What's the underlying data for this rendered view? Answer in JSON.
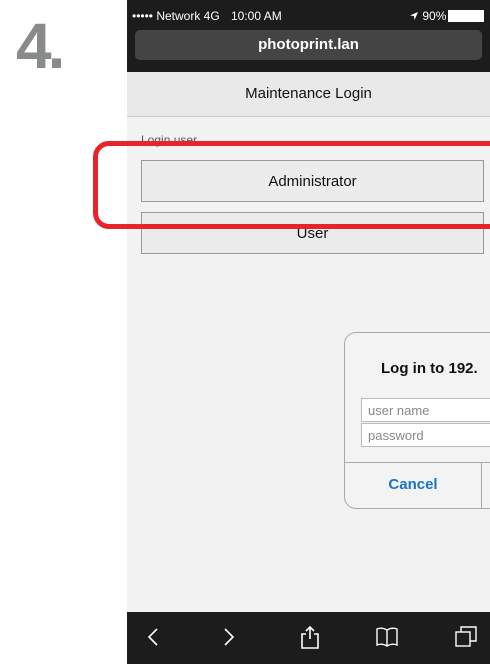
{
  "step_number": "4.",
  "status_bar": {
    "carrier": "••••• Network 4G",
    "time": "10:00 AM",
    "battery": "90%"
  },
  "url": "photoprint.lan",
  "page_title": "Maintenance Login",
  "login_user_label": "Login user",
  "buttons": {
    "administrator": "Administrator",
    "user": "User"
  },
  "dialog": {
    "title": "Log in to 192.",
    "username_placeholder": "user name",
    "password_placeholder": "password",
    "cancel": "Cancel"
  },
  "toolbar": {
    "icons": [
      "back-icon",
      "forward-icon",
      "share-icon",
      "bookmarks-icon",
      "tabs-icon"
    ]
  },
  "colors": {
    "highlight": "#e8232b",
    "cancel_text": "#1a73c8"
  }
}
